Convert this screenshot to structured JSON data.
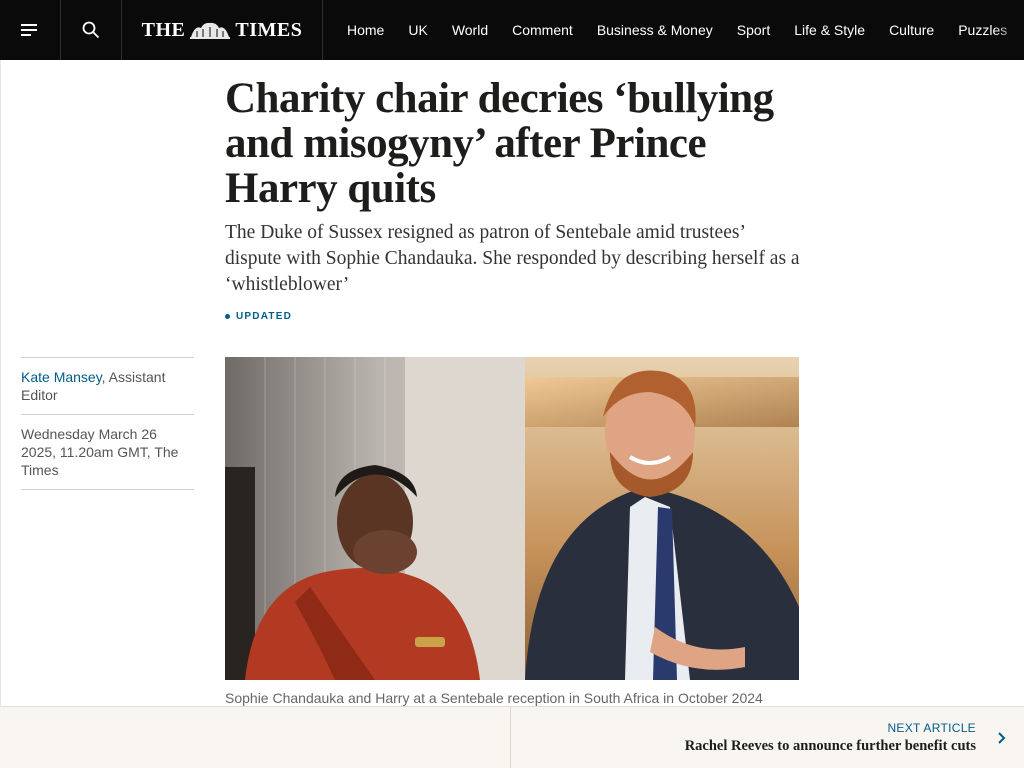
{
  "nav": {
    "menu_icon": "hamburger-menu-icon",
    "search_icon": "search-icon",
    "logo_text_left": "THE",
    "logo_text_right": "TIMES",
    "links": [
      "Home",
      "UK",
      "World",
      "Comment",
      "Business & Money",
      "Sport",
      "Life & Style",
      "Culture",
      "Puzzles"
    ]
  },
  "article": {
    "headline": "Charity chair decries ‘bullying and misogyny’ after Prince Harry quits",
    "standfirst": "The Duke of Sussex resigned as patron of Sentebale amid trustees’ dispute with Sophie Chandauka. She responded by describing herself as a ‘whistleblower’",
    "status": "UPDATED",
    "author_name": "Kate Mansey",
    "author_role": ", Assistant Editor",
    "date": "Wednesday March 26 2025, 11.20am GMT, The Times",
    "image_caption": "Sophie Chandauka and Harry at a Sentebale reception in South Africa in October 2024"
  },
  "next_article": {
    "label": "NEXT ARTICLE",
    "title": "Rachel Reeves to announce further benefit cuts",
    "icon": "chevron-right-icon"
  },
  "colors": {
    "nav_bg": "#0a0a0b",
    "accent_link": "#005c8a",
    "next_bar_bg": "#f9f6f2"
  }
}
